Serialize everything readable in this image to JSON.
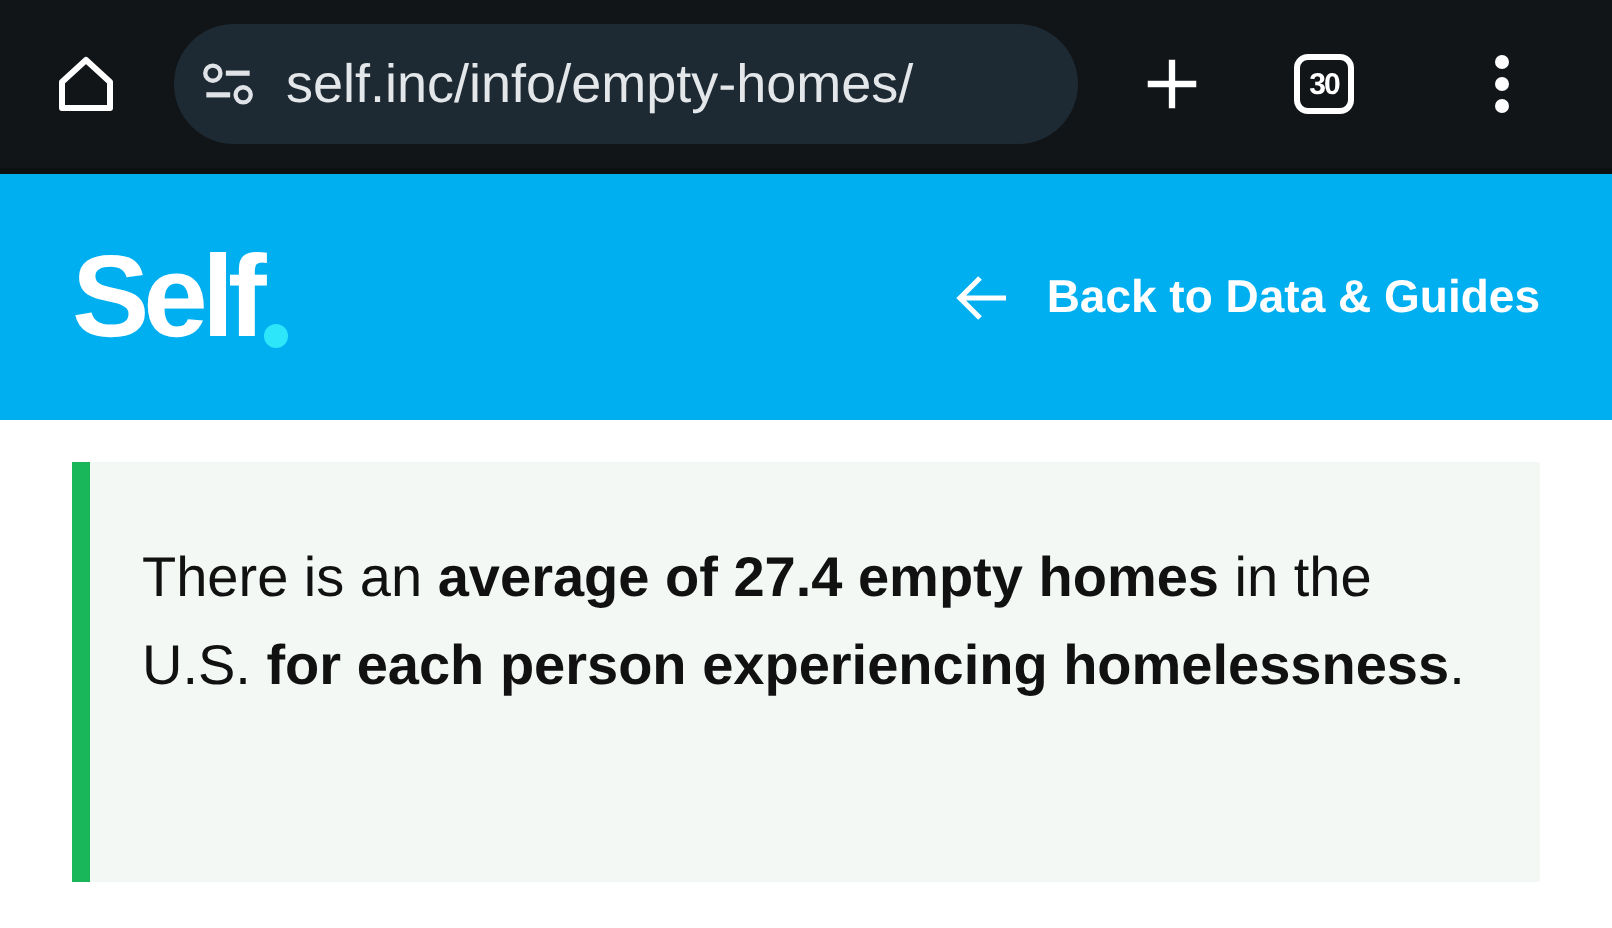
{
  "browser": {
    "url": "self.inc/info/empty-homes/",
    "tab_count": "30"
  },
  "header": {
    "logo": "Self",
    "back_link": "Back to Data & Guides"
  },
  "callout": {
    "text": "There is an **average of 27.4 empty homes** in the U.S. **for each person experiencing homelessness**."
  }
}
